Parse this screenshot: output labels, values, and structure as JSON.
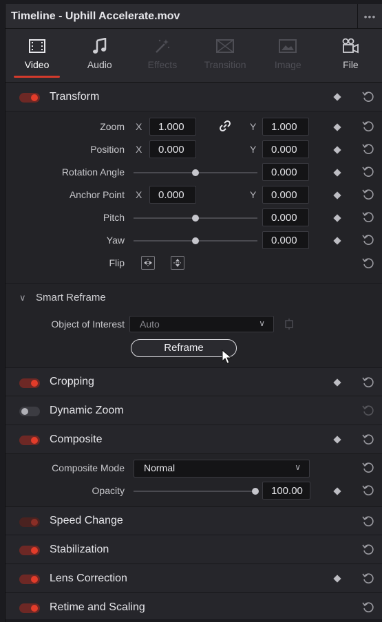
{
  "title": "Timeline - Uphill Accelerate.mov",
  "menu_icon": "ellipsis-icon",
  "tabs": [
    {
      "label": "Video",
      "icon": "film-icon",
      "state": "active"
    },
    {
      "label": "Audio",
      "icon": "music-note-icon",
      "state": "normal"
    },
    {
      "label": "Effects",
      "icon": "magic-wand-icon",
      "state": "disabled"
    },
    {
      "label": "Transition",
      "icon": "transition-icon",
      "state": "disabled"
    },
    {
      "label": "Image",
      "icon": "image-icon",
      "state": "disabled"
    },
    {
      "label": "File",
      "icon": "film-reel-icon",
      "state": "normal"
    }
  ],
  "transform": {
    "title": "Transform",
    "zoom": {
      "label": "Zoom",
      "x_axis": "X",
      "x": "1.000",
      "y_axis": "Y",
      "y": "1.000"
    },
    "position": {
      "label": "Position",
      "x_axis": "X",
      "x": "0.000",
      "y_axis": "Y",
      "y": "0.000"
    },
    "rotation": {
      "label": "Rotation Angle",
      "value": "0.000"
    },
    "anchor": {
      "label": "Anchor Point",
      "x_axis": "X",
      "x": "0.000",
      "y_axis": "Y",
      "y": "0.000"
    },
    "pitch": {
      "label": "Pitch",
      "value": "0.000"
    },
    "yaw": {
      "label": "Yaw",
      "value": "0.000"
    },
    "flip": {
      "label": "Flip"
    }
  },
  "smart_reframe": {
    "title": "Smart Reframe",
    "object_label": "Object of Interest",
    "object_value": "Auto",
    "button": "Reframe"
  },
  "sections": {
    "cropping": "Cropping",
    "dynamic_zoom": "Dynamic Zoom",
    "composite": "Composite",
    "speed_change": "Speed Change",
    "stabilization": "Stabilization",
    "lens_correction": "Lens Correction",
    "retime_scaling": "Retime and Scaling"
  },
  "composite": {
    "mode_label": "Composite Mode",
    "mode_value": "Normal",
    "opacity_label": "Opacity",
    "opacity_value": "100.00"
  },
  "colors": {
    "accent": "#e23c2a",
    "panel": "#232327"
  }
}
